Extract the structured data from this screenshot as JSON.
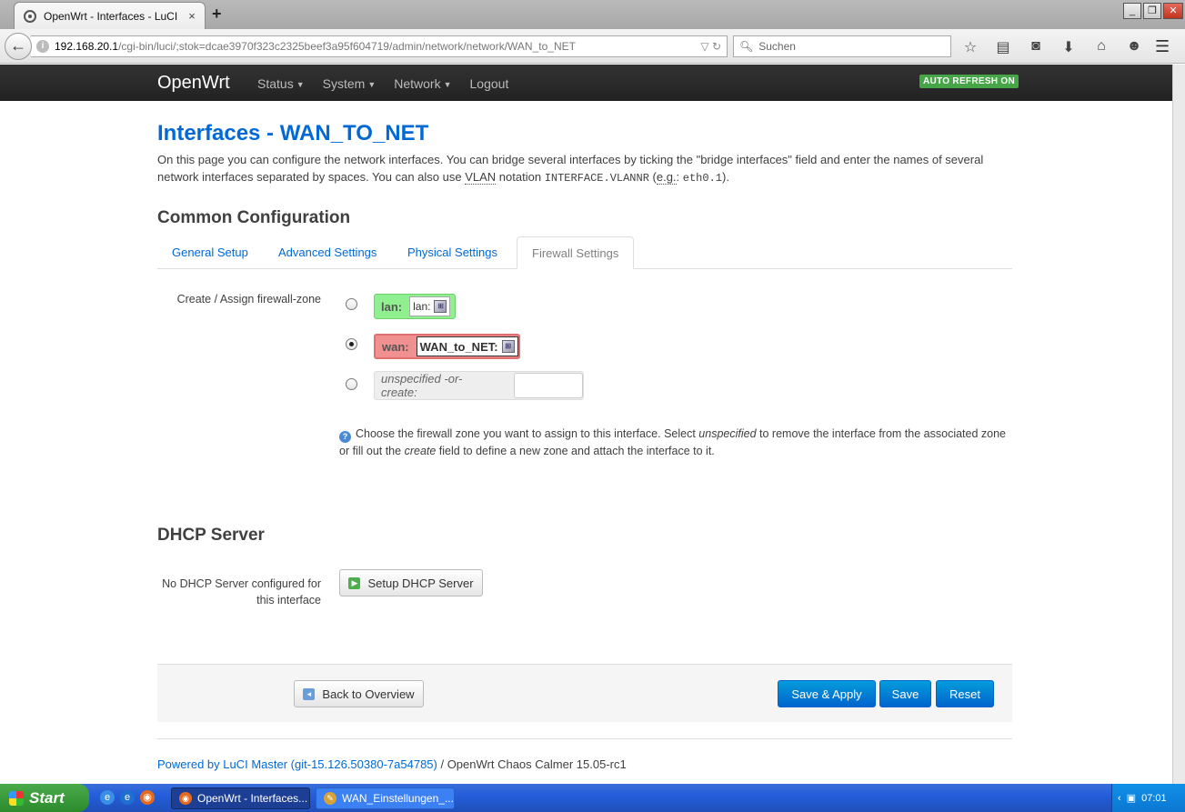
{
  "browser": {
    "tab_title": "OpenWrt - Interfaces - LuCI",
    "tab_close": "×",
    "new_tab": "+",
    "url_host": "192.168.20.1",
    "url_path": "/cgi-bin/luci/;stok=dcae3970f323c2325beef3a95f604719/admin/network/network/WAN_to_NET",
    "url_controls": "▽ ↻",
    "search_placeholder": "Suchen",
    "window_buttons": [
      "_",
      "❐",
      "✕"
    ]
  },
  "header": {
    "brand": "OpenWrt",
    "nav": [
      "Status",
      "System",
      "Network",
      "Logout"
    ],
    "auto_refresh": "AUTO REFRESH ON"
  },
  "page": {
    "title": "Interfaces - WAN_TO_NET",
    "desc_1": "On this page you can configure the network interfaces. You can bridge several interfaces by ticking the \"bridge interfaces\" field and enter the names of several network interfaces separated by spaces. You can also use ",
    "desc_vlan": "VLAN",
    "desc_2": " notation ",
    "desc_code1": "INTERFACE.VLANNR",
    "desc_3": " (",
    "desc_eg": "e.g.",
    "desc_4": ": ",
    "desc_code2": "eth0.1",
    "desc_5": ")."
  },
  "common": {
    "title": "Common Configuration",
    "tabs": [
      "General Setup",
      "Advanced Settings",
      "Physical Settings",
      "Firewall Settings"
    ],
    "active_tab": "Firewall Settings"
  },
  "firewall": {
    "label": "Create / Assign firewall-zone",
    "zones": [
      {
        "name": "lan:",
        "iface": "lan:",
        "checked": false,
        "color": "#90f090"
      },
      {
        "name": "wan:",
        "iface": "WAN_to_NET:",
        "checked": true,
        "color": "#f09090"
      }
    ],
    "unspecified_label": "unspecified -or- create:",
    "create_value": "",
    "hint_1": "Choose the firewall zone you want to assign to this interface. Select ",
    "hint_em1": "unspecified",
    "hint_2": " to remove the interface from the associated zone or fill out the ",
    "hint_em2": "create",
    "hint_3": " field to define a new zone and attach the interface to it."
  },
  "dhcp": {
    "title": "DHCP Server",
    "label_line1": "No DHCP Server configured for",
    "label_line2": "this interface",
    "setup_button": "Setup DHCP Server"
  },
  "actions": {
    "back": "Back to Overview",
    "save_apply": "Save & Apply",
    "save": "Save",
    "reset": "Reset"
  },
  "footer": {
    "link": "Powered by LuCI Master (git-15.126.50380-7a54785)",
    "rest": " / OpenWrt Chaos Calmer 15.05-rc1"
  },
  "taskbar": {
    "start": "Start",
    "items": [
      "OpenWrt - Interfaces...",
      "WAN_Einstellungen_..."
    ],
    "clock": "07:01"
  },
  "colors": {
    "accent": "#0069d6",
    "header_bg": "#222222",
    "primary_button": "#0064cd",
    "auto_refresh": "#46a546"
  }
}
